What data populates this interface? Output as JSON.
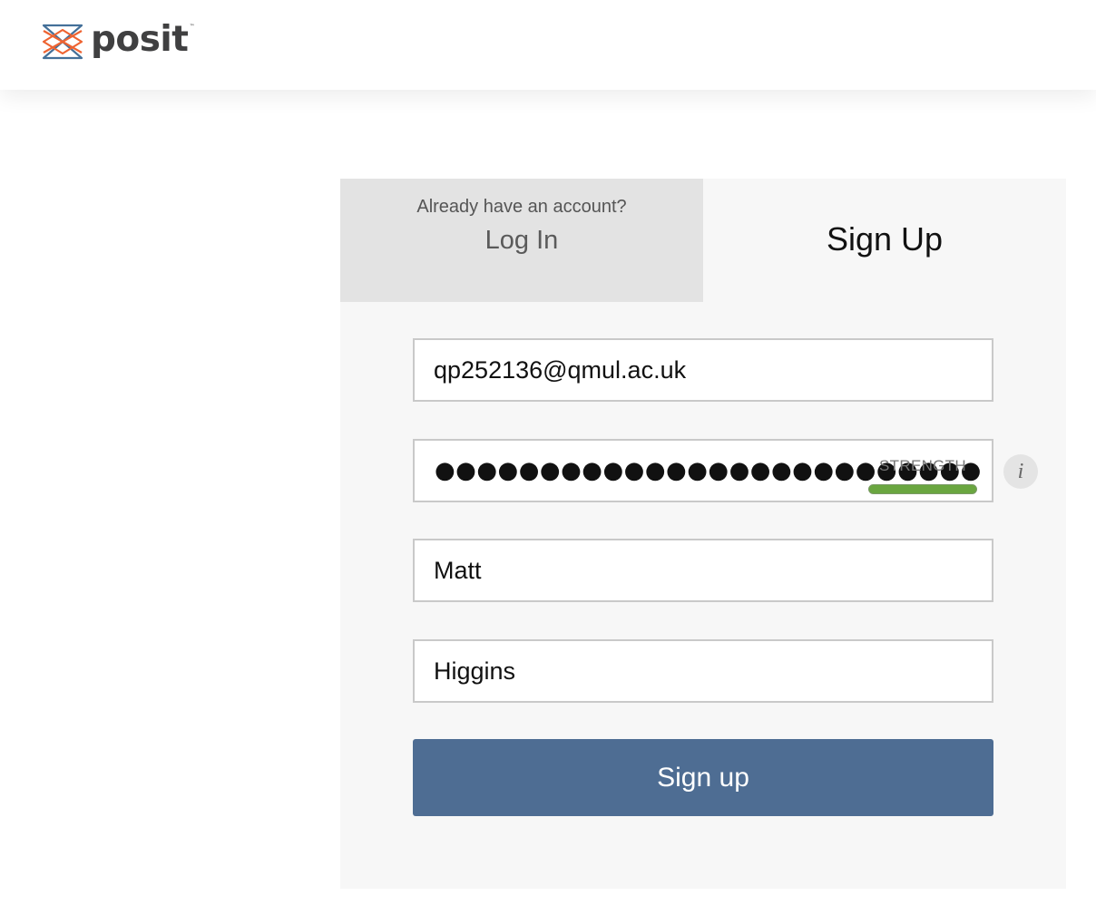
{
  "header": {
    "logo_text": "posit",
    "logo_tm": "™",
    "logo_icon": "posit-x-logo-icon",
    "colors": {
      "blue": "#447099",
      "orange": "#EE6331",
      "text": "#404041"
    }
  },
  "auth": {
    "login_tab": {
      "hint": "Already have an account?",
      "label": "Log In"
    },
    "signup_tab": {
      "label": "Sign Up"
    },
    "form": {
      "email": {
        "value": "qp252136@qmul.ac.uk"
      },
      "password": {
        "masked_value": "●●●●●●●●●●●●●●●●●●●●●●●●●●",
        "strength_label": "STRENGTH",
        "strength_level": 1.0,
        "strength_color": "#6aa640",
        "info_icon": "info-icon",
        "info_glyph": "i"
      },
      "first_name": {
        "value": "Matt"
      },
      "last_name": {
        "value": "Higgins"
      },
      "submit_label": "Sign up",
      "submit_color": "#4e6d93"
    }
  }
}
